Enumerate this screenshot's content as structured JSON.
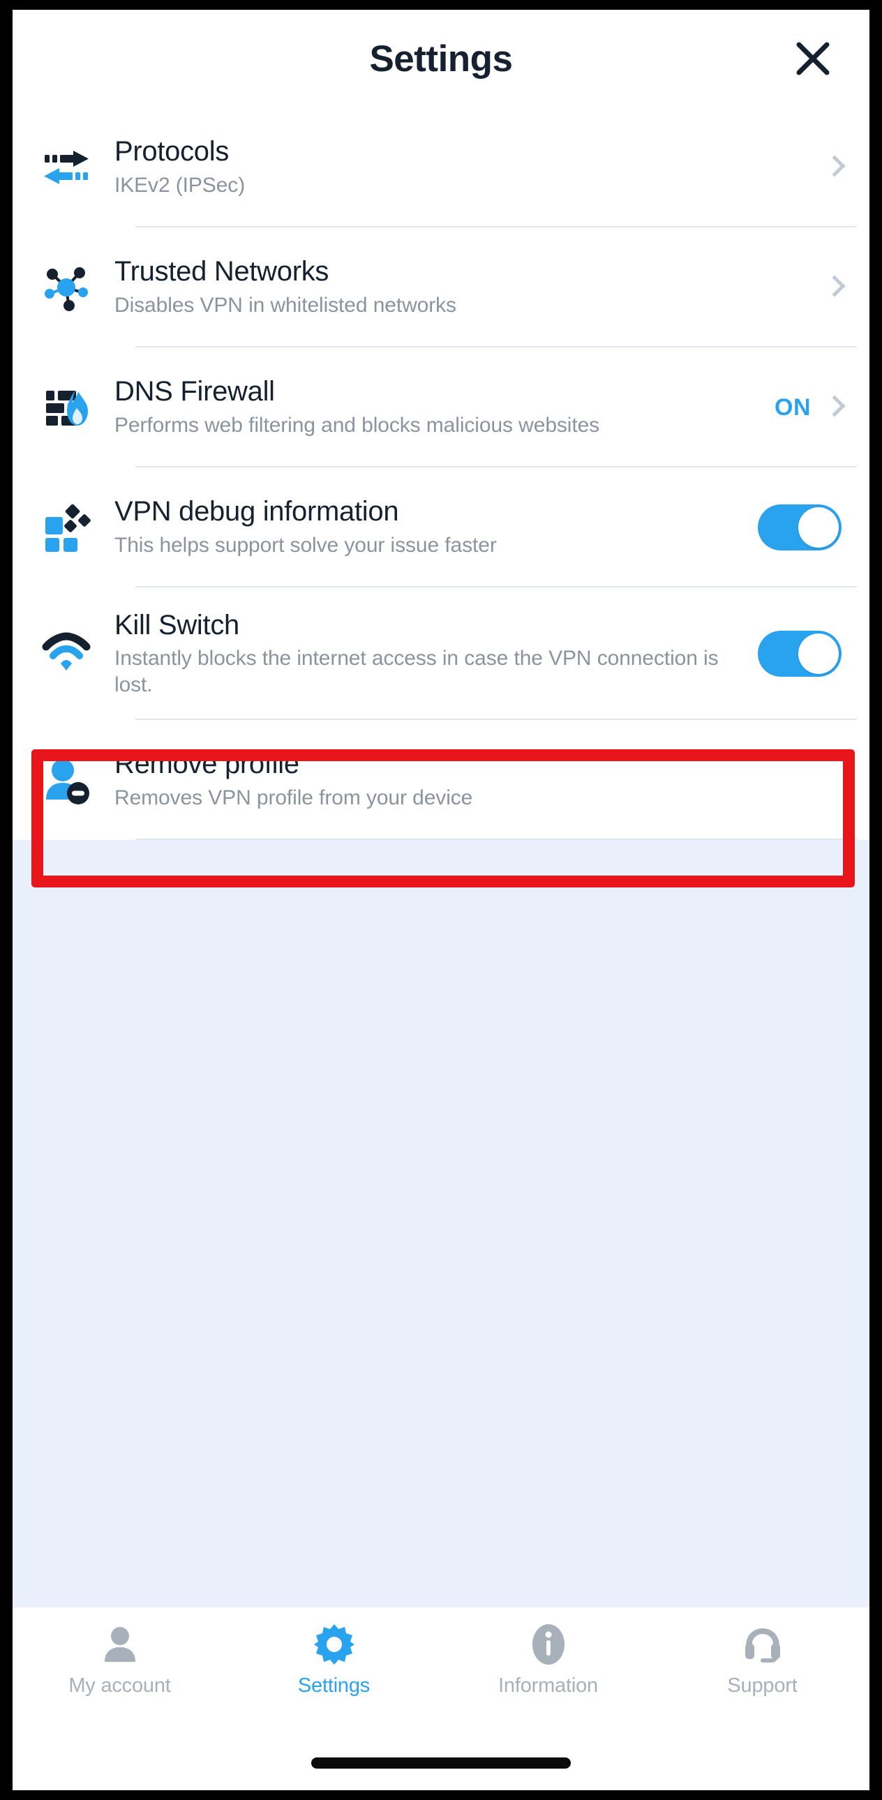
{
  "header": {
    "title": "Settings",
    "close_icon": "close-icon"
  },
  "colors": {
    "accent_blue": "#2aa3ee",
    "dark_navy": "#16212f",
    "subtitle_gray": "#8b949e",
    "highlight_red": "#e8161b",
    "page_background": "#e9f0fb",
    "card_background": "#ffffff"
  },
  "settings": {
    "rows": [
      {
        "key": "protocols",
        "icon": "protocol-arrows-icon",
        "title": "Protocols",
        "subtitle": "IKEv2 (IPSec)",
        "accessory": "chevron",
        "status": "",
        "toggle_on": false,
        "highlighted": false
      },
      {
        "key": "trusted-networks",
        "icon": "network-nodes-icon",
        "title": "Trusted Networks",
        "subtitle": "Disables VPN in whitelisted networks",
        "accessory": "chevron",
        "status": "",
        "toggle_on": false,
        "highlighted": false
      },
      {
        "key": "dns-firewall",
        "icon": "firewall-flame-icon",
        "title": "DNS Firewall",
        "subtitle": "Performs web filtering and blocks malicious websites",
        "accessory": "status-chevron",
        "status": "ON",
        "toggle_on": false,
        "highlighted": false
      },
      {
        "key": "vpn-debug-information",
        "icon": "debug-blocks-icon",
        "title": "VPN debug information",
        "subtitle": "This helps support solve your issue faster",
        "accessory": "toggle",
        "status": "",
        "toggle_on": true,
        "highlighted": false
      },
      {
        "key": "kill-switch",
        "icon": "wifi-signal-icon",
        "title": "Kill Switch",
        "subtitle": "Instantly blocks the internet access in case the VPN connection is lost.",
        "accessory": "toggle",
        "status": "",
        "toggle_on": true,
        "highlighted": true
      },
      {
        "key": "remove-profile",
        "icon": "user-remove-icon",
        "title": "Remove profile",
        "subtitle": "Removes VPN profile from your device",
        "accessory": "none",
        "status": "",
        "toggle_on": false,
        "highlighted": false
      }
    ]
  },
  "tab_bar": {
    "items": [
      {
        "key": "my-account",
        "label": "My account",
        "icon": "person-icon",
        "active": false
      },
      {
        "key": "settings",
        "label": "Settings",
        "icon": "gear-icon",
        "active": true
      },
      {
        "key": "information",
        "label": "Information",
        "icon": "info-icon",
        "active": false
      },
      {
        "key": "support",
        "label": "Support",
        "icon": "headset-icon",
        "active": false
      }
    ]
  }
}
